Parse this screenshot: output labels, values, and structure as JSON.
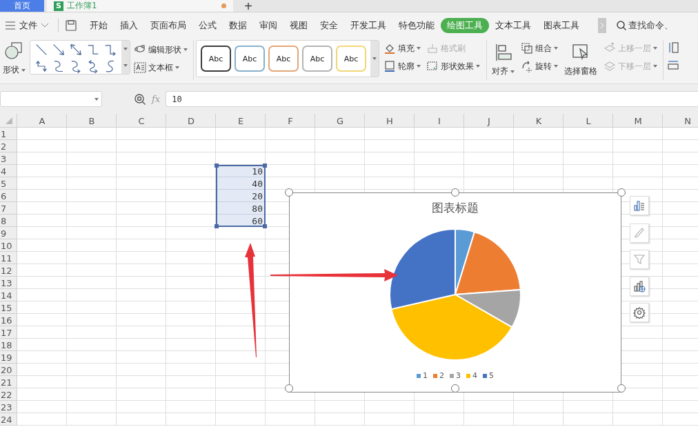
{
  "tabs": [
    {
      "label": "首页",
      "selected": false
    },
    {
      "label": "工作簿1",
      "icon_letter": "S",
      "selected": true,
      "modified": true
    }
  ],
  "new_tab_button": "+",
  "menu": {
    "file": "文件",
    "items": [
      {
        "label": "开始",
        "selected": false
      },
      {
        "label": "插入",
        "selected": false
      },
      {
        "label": "页面布局",
        "selected": false
      },
      {
        "label": "公式",
        "selected": false
      },
      {
        "label": "数据",
        "selected": false
      },
      {
        "label": "审阅",
        "selected": false
      },
      {
        "label": "视图",
        "selected": false
      },
      {
        "label": "安全",
        "selected": false
      },
      {
        "label": "开发工具",
        "selected": false
      },
      {
        "label": "特色功能",
        "selected": false
      },
      {
        "label": "绘图工具",
        "selected": true
      },
      {
        "label": "文本工具",
        "selected": false
      },
      {
        "label": "图表工具",
        "selected": false
      }
    ],
    "search_placeholder": "查找命令、"
  },
  "ribbon": {
    "shape_button": {
      "label": "形状",
      "dropdown": true
    },
    "shape_tools": [
      {
        "label": "编辑形状",
        "dropdown": true
      },
      {
        "label": "文本框",
        "dropdown": true
      }
    ],
    "style_presets": [
      {
        "label": "Abc",
        "color": "#3c3c3c"
      },
      {
        "label": "Abc",
        "color": "#86b0cc"
      },
      {
        "label": "Abc",
        "color": "#e3a679"
      },
      {
        "label": "Abc",
        "color": "#b4b4b4"
      },
      {
        "label": "Abc",
        "color": "#f2d675"
      }
    ],
    "format_tools": [
      {
        "label": "填充",
        "disabled": false,
        "dropdown": true
      },
      {
        "label": "格式刷",
        "disabled": true,
        "dropdown": false
      },
      {
        "label": "轮廓",
        "disabled": false,
        "dropdown": true
      },
      {
        "label": "形状效果",
        "disabled": false,
        "dropdown": true
      }
    ],
    "arrange_tools": [
      {
        "label": "对齐",
        "kind": "large",
        "disabled": false,
        "dropdown": true
      },
      {
        "label": "组合",
        "kind": "small",
        "disabled": false,
        "dropdown": true
      },
      {
        "label": "旋转",
        "kind": "small",
        "disabled": false,
        "dropdown": true
      },
      {
        "label": "选择窗格",
        "kind": "large",
        "disabled": false,
        "dropdown": false
      },
      {
        "label": "上移一层",
        "kind": "small",
        "disabled": true,
        "dropdown": true
      },
      {
        "label": "下移一层",
        "kind": "small",
        "disabled": true,
        "dropdown": true
      }
    ]
  },
  "formula_bar": {
    "function_label": "fx",
    "value": "10"
  },
  "sheet": {
    "columns": [
      "A",
      "B",
      "C",
      "D",
      "E",
      "F",
      "G",
      "H",
      "I",
      "J",
      "K",
      "L",
      "M",
      "N"
    ],
    "rows": [
      {
        "label": "1",
        "selected": false
      },
      {
        "label": "2",
        "selected": false
      },
      {
        "label": "3",
        "selected": false
      },
      {
        "label": "4",
        "column_e": "10",
        "selected": true
      },
      {
        "label": "5",
        "column_e": "40",
        "selected": true
      },
      {
        "label": "6",
        "column_e": "20",
        "selected": true
      },
      {
        "label": "7",
        "column_e": "80",
        "selected": true
      },
      {
        "label": "8",
        "column_e": "60",
        "selected": true
      },
      {
        "label": "9",
        "selected": false
      },
      {
        "label": "10",
        "selected": false
      },
      {
        "label": "11",
        "selected": false
      },
      {
        "label": "12",
        "selected": false
      },
      {
        "label": "13",
        "selected": false
      },
      {
        "label": "14",
        "selected": false
      },
      {
        "label": "15",
        "selected": false
      },
      {
        "label": "16",
        "selected": false
      },
      {
        "label": "17",
        "selected": false
      },
      {
        "label": "18",
        "selected": false
      },
      {
        "label": "19",
        "selected": false
      },
      {
        "label": "20",
        "selected": false
      },
      {
        "label": "21",
        "selected": false
      },
      {
        "label": "22",
        "selected": false
      },
      {
        "label": "23",
        "selected": false
      },
      {
        "label": "24",
        "selected": false
      }
    ],
    "chart": {
      "chart_data": {
        "type": "pie",
        "title": "图表标题",
        "categories": [
          "1",
          "2",
          "3",
          "4",
          "5"
        ],
        "values": [
          4.76,
          19.05,
          9.52,
          38.1,
          28.57
        ],
        "legend": "bottom",
        "colors": [
          "#5b9bd5",
          "#ed7d31",
          "#a5a5a5",
          "#ffc000",
          "#4472c4"
        ]
      }
    }
  }
}
